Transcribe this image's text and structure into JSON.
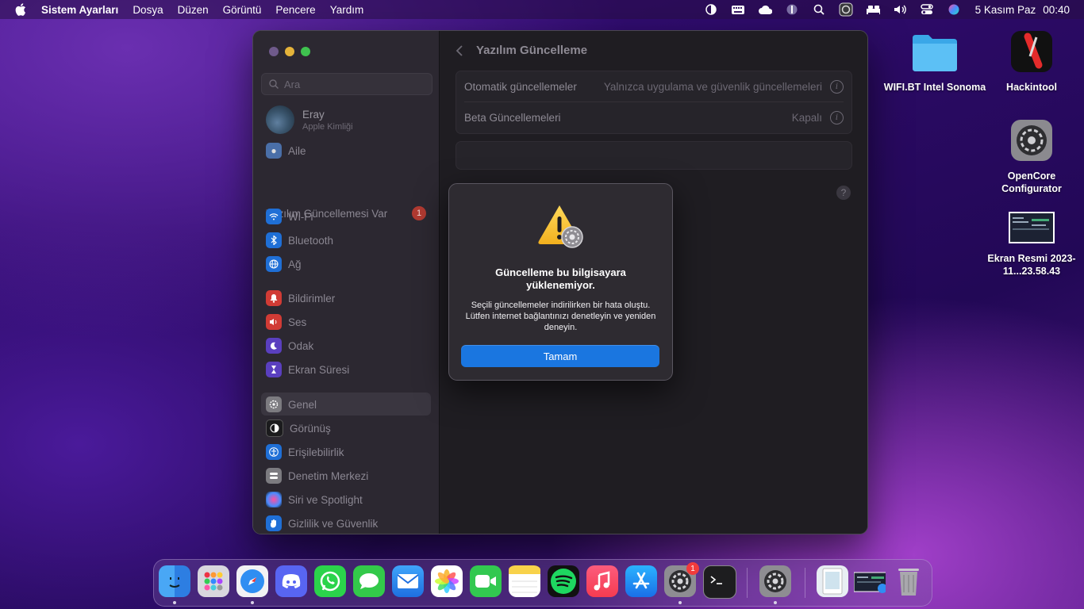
{
  "menubar": {
    "app_name": "Sistem Ayarları",
    "menus": [
      "Dosya",
      "Düzen",
      "Görüntü",
      "Pencere",
      "Yardım"
    ],
    "date": "5 Kasım Paz",
    "time": "00:40"
  },
  "window": {
    "search_placeholder": "Ara",
    "profile": {
      "name": "Eray",
      "subtitle": "Apple Kimliği"
    },
    "family_label": "Aile",
    "update_notice": {
      "label": "Yazılım Güncellemesi Var",
      "count": "1"
    },
    "sidebar_items": [
      {
        "label": "Wi-Fi",
        "color": "#1f6fd6"
      },
      {
        "label": "Bluetooth",
        "color": "#1f6fd6"
      },
      {
        "label": "Ağ",
        "color": "#1f6fd6"
      },
      {
        "label": "Bildirimler",
        "color": "#d13b35"
      },
      {
        "label": "Ses",
        "color": "#d13b35"
      },
      {
        "label": "Odak",
        "color": "#5a3fbf"
      },
      {
        "label": "Ekran Süresi",
        "color": "#5a3fbf"
      },
      {
        "label": "Genel",
        "color": "#7c7b80"
      },
      {
        "label": "Görünüş",
        "color": "#1b1b1d"
      },
      {
        "label": "Erişilebilirlik",
        "color": "#1f6fd6"
      },
      {
        "label": "Denetim Merkezi",
        "color": "#7c7b80"
      },
      {
        "label": "Siri ve Spotlight",
        "color": "#9b3fd1"
      },
      {
        "label": "Gizlilik ve Güvenlik",
        "color": "#1f6fd6"
      }
    ],
    "page_title": "Yazılım Güncelleme",
    "settings": [
      {
        "label": "Otomatik güncellemeler",
        "value": "Yalnızca uygulama ve güvenlik güncellemeleri"
      },
      {
        "label": "Beta Güncellemeleri",
        "value": "Kapalı"
      }
    ],
    "help_label": "?"
  },
  "dialog": {
    "title": "Güncelleme bu bilgisayara yüklenemiyor.",
    "message": "Seçili güncellemeler indirilirken bir hata oluştu. Lütfen internet bağlantınızı denetleyin ve yeniden deneyin.",
    "button": "Tamam"
  },
  "desktop": [
    {
      "label": "WIFI.BT Intel Sonoma",
      "icon": "folder-icon"
    },
    {
      "label": "Hackintool",
      "icon": "hackintool-icon"
    },
    {
      "label": "OpenCore Configurator",
      "icon": "opencore-icon"
    },
    {
      "label": "Ekran Resmi 2023-11...23.58.43",
      "icon": "screenshot-file-icon"
    }
  ],
  "dock": {
    "system_settings_badge": "1",
    "apps": [
      "Finder",
      "Launchpad",
      "Safari",
      "Discord",
      "WhatsApp",
      "Mesajlar",
      "Mail",
      "Fotoğraflar",
      "FaceTime",
      "Notlar",
      "Spotify",
      "Müzik",
      "App Store",
      "Sistem Ayarları",
      "Terminal",
      "OpenCore Configurator",
      "Önizleme",
      "Ekran Resmi",
      "Çöp Sepeti"
    ]
  }
}
